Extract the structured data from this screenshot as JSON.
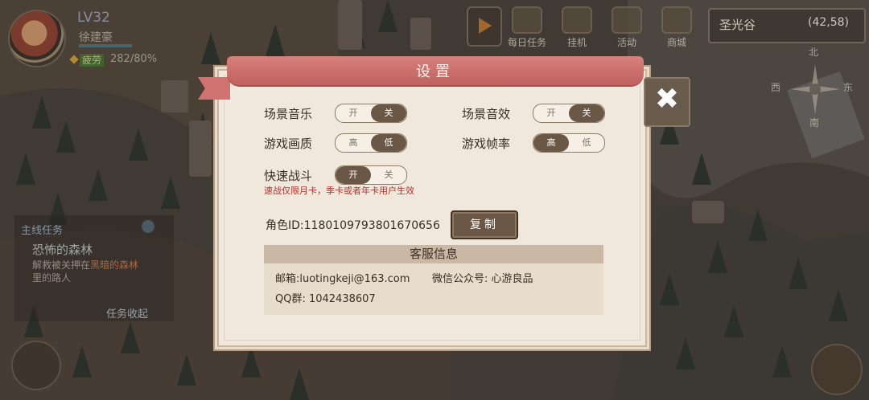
{
  "player": {
    "level": "LV32",
    "name": "徐建豪",
    "fatigue_label": "疲劳",
    "fatigue_value": "282/80%"
  },
  "top_menu": [
    {
      "label": "每日任务",
      "icon": "calendar-icon"
    },
    {
      "label": "挂机",
      "icon": "crossed-swords-icon"
    },
    {
      "label": "活动",
      "icon": "gift-icon"
    },
    {
      "label": "商城",
      "icon": "shop-icon"
    }
  ],
  "location": {
    "name": "圣光谷",
    "coords": "(42,58)"
  },
  "compass": {
    "n": "北",
    "w": "西",
    "e": "东",
    "s": "南"
  },
  "quest": {
    "header": "主线任务",
    "title": "恐怖的森林",
    "desc_prefix": "解救被关押在",
    "desc_highlight": "黑暗的森林",
    "desc_suffix": "里的路人",
    "toggle": "任务收起"
  },
  "settings": {
    "title": "设置",
    "close": "✖",
    "rows": [
      {
        "label": "场景音乐",
        "on": "开",
        "off": "关",
        "selected": "关"
      },
      {
        "label": "场景音效",
        "on": "开",
        "off": "关",
        "selected": "关"
      },
      {
        "label": "游戏画质",
        "on": "高",
        "off": "低",
        "selected": "低"
      },
      {
        "label": "游戏帧率",
        "on": "高",
        "off": "低",
        "selected": "高"
      },
      {
        "label": "快速战斗",
        "on": "开",
        "off": "关",
        "selected": "开"
      }
    ],
    "fast_battle_note": "速战仅限月卡，季卡或者年卡用户生效",
    "role_id": "角色ID:1180109793801670656",
    "copy_label": "复制",
    "service_header": "客服信息",
    "email": "邮箱:luotingkeji@163.com",
    "wechat": "微信公众号: 心游良品",
    "qq": "QQ群: 1042438607"
  },
  "colors": {
    "ribbon": "#c96a67",
    "toggle_active": "#6a5745",
    "warning_text": "#b2342c",
    "panel_bg": "#f0e8dc"
  }
}
